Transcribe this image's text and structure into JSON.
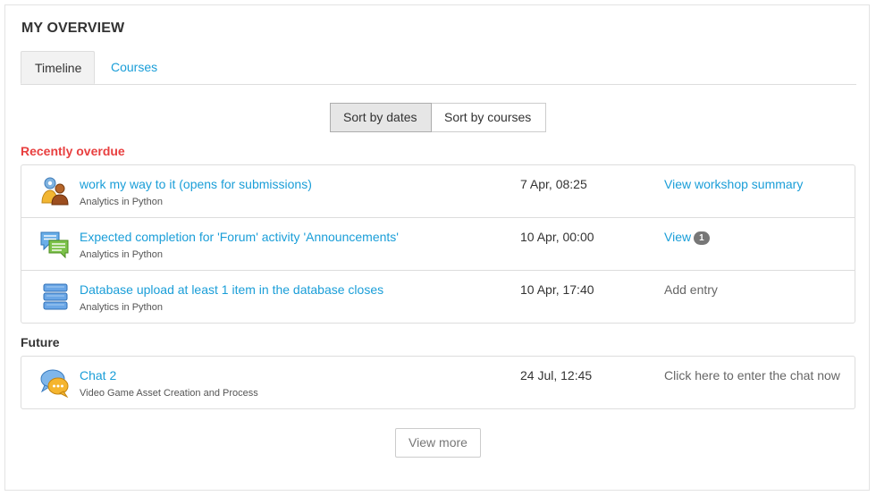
{
  "block": {
    "title": "MY OVERVIEW"
  },
  "tabs": [
    {
      "label": "Timeline",
      "active": true
    },
    {
      "label": "Courses",
      "active": false
    }
  ],
  "sort": {
    "by_dates": "Sort by dates",
    "by_courses": "Sort by courses",
    "selected": "Sort by dates"
  },
  "sections": {
    "overdue": {
      "label": "Recently overdue",
      "color": "#e83f3f",
      "events": [
        {
          "icon": "workshop-icon",
          "name": "work my way to it (opens for submissions)",
          "course": "Analytics in Python",
          "date": "7 Apr, 08:25",
          "action": "View workshop summary",
          "action_link": true
        },
        {
          "icon": "forum-icon",
          "name": "Expected completion for 'Forum' activity 'Announcements'",
          "course": "Analytics in Python",
          "date": "10 Apr, 00:00",
          "action": "View",
          "badge": "1",
          "action_link": true
        },
        {
          "icon": "database-icon",
          "name": "Database upload at least 1 item in the database closes",
          "course": "Analytics in Python",
          "date": "10 Apr, 17:40",
          "action": "Add entry",
          "action_link": false
        }
      ]
    },
    "future": {
      "label": "Future",
      "events": [
        {
          "icon": "chat-icon",
          "name": "Chat 2",
          "course": "Video Game Asset Creation and Process",
          "date": "24 Jul, 12:45",
          "action": "Click here to enter the chat now",
          "action_link": false
        }
      ]
    }
  },
  "view_more": "View more",
  "colors": {
    "link": "#1a9ed8",
    "overdue": "#e83f3f",
    "badge": "#777777"
  }
}
